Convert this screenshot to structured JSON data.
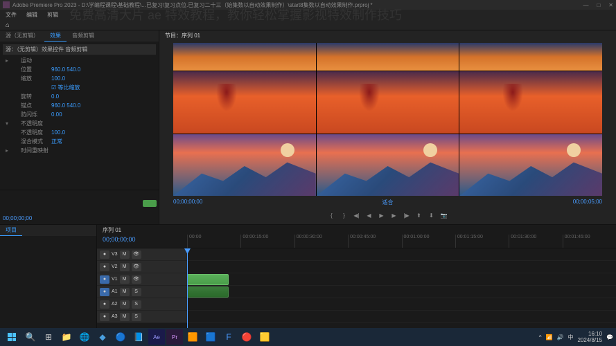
{
  "titlebar": {
    "title": "Adobe Premiere Pro 2023 - D:\\学编程课程\\基础教程\\...已复习\\复习点位.已复习二十三（始集数以自动效果制作）\\start8集数以自动效果制作.prproj *"
  },
  "overlay": {
    "title": "免费高清大片 ae 特效教程，教你轻松掌握影视特效制作技巧"
  },
  "menubar": {
    "items": [
      "文件",
      "编辑",
      "剪辑"
    ]
  },
  "workspace_tabs": [
    "效果",
    "音频剪辑"
  ],
  "effect_panel": {
    "header": "源：（无剪辑）效果控件  音频剪辑",
    "sections": [
      {
        "name": "运动",
        "rows": [
          {
            "label": "位置",
            "value": "960.0  540.0"
          },
          {
            "label": "缩放",
            "value": "100.0"
          },
          {
            "label": "",
            "value": "☑ 等比缩放"
          },
          {
            "label": "旋转",
            "value": "0.0"
          },
          {
            "label": "锚点",
            "value": "960.0  540.0"
          },
          {
            "label": "防闪烁",
            "value": "0.00"
          }
        ]
      },
      {
        "name": "不透明度",
        "rows": [
          {
            "label": "不透明度",
            "value": "100.0"
          },
          {
            "label": "混合模式",
            "value": "正常"
          }
        ]
      },
      {
        "name": "时间重映射",
        "rows": []
      }
    ]
  },
  "preview": {
    "tab_label": "节目：序列 01",
    "time_left": "00;00;00;00",
    "time_right": "00;00;05;00",
    "fit_label": "适合"
  },
  "timeline": {
    "title": "序列 01",
    "timecode": "00;00;00;00",
    "marks": [
      "00:00",
      "00:00:15:00",
      "00:00:30:00",
      "00:00:45:00",
      "00:01:00:00",
      "00:01:15:00",
      "00:01:30:00",
      "00:01:45:00"
    ],
    "tracks": [
      {
        "name": "V3",
        "type": "video"
      },
      {
        "name": "V2",
        "type": "video"
      },
      {
        "name": "V1",
        "type": "video",
        "clip": {
          "left": 0,
          "width": 60
        }
      },
      {
        "name": "A1",
        "type": "audio",
        "clip": {
          "left": 0,
          "width": 60
        }
      },
      {
        "name": "A2",
        "type": "audio"
      },
      {
        "name": "A3",
        "type": "audio"
      }
    ]
  },
  "mini_timeline": {
    "time": "00;00;00;00"
  },
  "taskbar": {
    "time": "16:10",
    "date": "2024/8/15"
  }
}
